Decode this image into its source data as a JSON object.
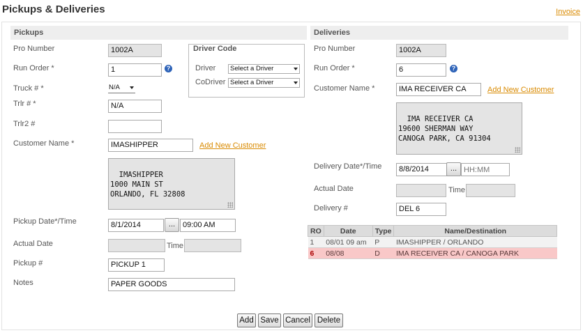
{
  "page": {
    "title": "Pickups & Deliveries",
    "invoice_link": "Invoice"
  },
  "pickups": {
    "heading": "Pickups",
    "pro_number": {
      "label": "Pro Number",
      "value": "1002A"
    },
    "run_order": {
      "label": "Run Order *",
      "value": "1",
      "help": "?"
    },
    "truck": {
      "label": "Truck # *",
      "value": "N/A"
    },
    "trlr": {
      "label": "Trlr # *",
      "value": "N/A"
    },
    "trlr2": {
      "label": "Trlr2 #",
      "value": ""
    },
    "customer": {
      "label": "Customer Name *",
      "value": "IMASHIPPER",
      "add_link": "Add New Customer",
      "address": "IMASHIPPER\n1000 MAIN ST\nORLANDO, FL 32808"
    },
    "pickup_datetime": {
      "label": "Pickup Date*/Time",
      "date": "8/1/2014",
      "picker": "...",
      "time": "09:00 AM"
    },
    "actual": {
      "label": "Actual Date",
      "date": "",
      "time_label": "Time",
      "time": ""
    },
    "pickup_no": {
      "label": "Pickup #",
      "value": "PICKUP 1"
    },
    "notes": {
      "label": "Notes",
      "value": "PAPER GOODS"
    }
  },
  "driver_code": {
    "legend": "Driver Code",
    "driver": {
      "label": "Driver",
      "value": "Select a Driver"
    },
    "codriver": {
      "label": "CoDriver",
      "value": "Select a Driver"
    }
  },
  "deliveries": {
    "heading": "Deliveries",
    "pro_number": {
      "label": "Pro Number",
      "value": "1002A"
    },
    "run_order": {
      "label": "Run Order *",
      "value": "6",
      "help": "?"
    },
    "customer": {
      "label": "Customer Name *",
      "value": "IMA RECEIVER CA",
      "add_link": "Add New Customer",
      "address": "IMA RECEIVER CA\n19600 SHERMAN WAY\nCANOGA PARK, CA 91304"
    },
    "delivery_datetime": {
      "label": "Delivery Date*/Time",
      "date": "8/8/2014",
      "picker": "...",
      "time_placeholder": "HH:MM"
    },
    "actual": {
      "label": "Actual Date",
      "date": "",
      "time_label": "Time",
      "time": ""
    },
    "delivery_no": {
      "label": "Delivery #",
      "value": "DEL 6"
    }
  },
  "runs_table": {
    "headers": [
      "RO",
      "Date",
      "Type",
      "Name/Destination"
    ],
    "rows": [
      {
        "ro": "1",
        "date": "08/01 09 am",
        "type": "P",
        "dest": "IMASHIPPER / ORLANDO"
      },
      {
        "ro": "6",
        "date": "08/08",
        "type": "D",
        "dest": "IMA RECEIVER CA / CANOGA PARK"
      }
    ]
  },
  "actions": {
    "add": "Add",
    "save": "Save",
    "cancel": "Cancel",
    "delete": "Delete"
  }
}
